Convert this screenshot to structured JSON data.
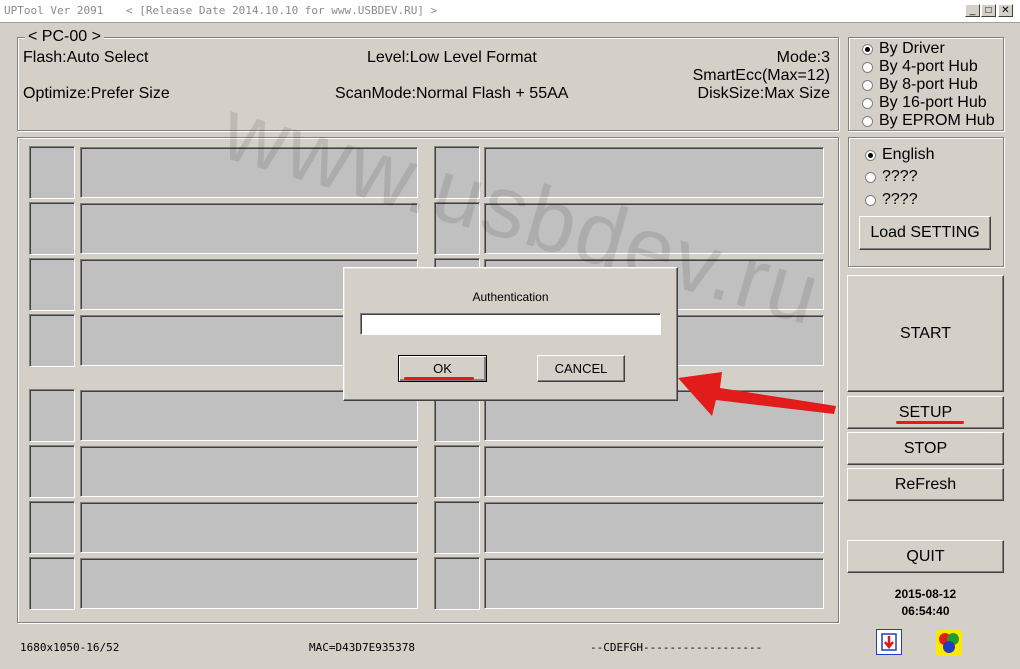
{
  "window": {
    "title": "UPTool Ver 2091",
    "subtitle": "< [Release Date 2014.10.10 for www.USBDEV.RU] >",
    "minimize": "_",
    "maximize": "□",
    "close": "✕"
  },
  "settings_panel": {
    "group_label": "< PC-00 >",
    "flash": "Flash:Auto Select",
    "level": "Level:Low Level Format",
    "mode": "Mode:3",
    "smartecc": "SmartEcc(Max=12)",
    "optimize": "Optimize:Prefer Size",
    "scanmode": "ScanMode:Normal Flash + 55AA",
    "disksize": "DiskSize:Max Size"
  },
  "hub_options": [
    {
      "label": "By Driver",
      "selected": true
    },
    {
      "label": "By 4-port Hub",
      "selected": false
    },
    {
      "label": "By 8-port Hub",
      "selected": false
    },
    {
      "label": "By 16-port Hub",
      "selected": false
    },
    {
      "label": "By EPROM Hub",
      "selected": false
    }
  ],
  "language_options": [
    {
      "label": "English",
      "selected": true
    },
    {
      "label": "????",
      "selected": false
    },
    {
      "label": "????",
      "selected": false
    }
  ],
  "buttons": {
    "load_setting": "Load SETTING",
    "start": "START",
    "setup": "SETUP",
    "stop": "STOP",
    "refresh": "ReFresh",
    "quit": "QUIT"
  },
  "clock": {
    "date": "2015-08-12",
    "time": "06:54:40"
  },
  "status_bar": {
    "resolution": "1680x1050-16/52",
    "mac": "MAC=D43D7E935378",
    "drives": "--CDEFGH------------------"
  },
  "dialog": {
    "title": "Authentication",
    "password_value": "",
    "ok": "OK",
    "cancel": "CANCEL"
  },
  "watermark": "www.usbdev.ru",
  "colors": {
    "background": "#d4d0c8",
    "slot": "#c0c0c0",
    "annotation": "#e21b1b"
  }
}
